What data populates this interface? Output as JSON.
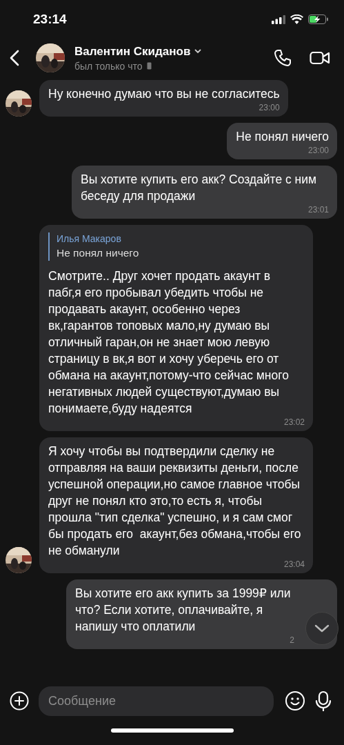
{
  "status_bar": {
    "time": "23:14"
  },
  "header": {
    "name": "Валентин Скиданов",
    "status": "был только что"
  },
  "messages": [
    {
      "kind": "incoming",
      "avatar": true,
      "text": "Ну конечно думаю что вы не согласитесь",
      "time": "23:00"
    },
    {
      "kind": "outgoing",
      "text": "Не понял ничего",
      "time": "23:00"
    },
    {
      "kind": "outgoing",
      "text": "Вы хотите купить его акк? Создайте с ним беседу для продажи",
      "time": "23:01"
    },
    {
      "kind": "incoming",
      "avatar": false,
      "reply": {
        "author": "Илья Макаров",
        "text": "Не понял ничего"
      },
      "text": "Смотрите.. Друг хочет продать акаунт в пабг,я его пробывал убедить чтобы не продавать акаунт, особенно через вк,гарантов топовых мало,ну думаю вы отличный гаран,он не знает мою левую страницу в вк,я вот и хочу уберечь его от обмана на акаунт,потому-что сейчас много негативных людей существуют,думаю вы понимаете,буду надеятся",
      "time": "23:02"
    },
    {
      "kind": "incoming",
      "avatar": true,
      "text": "Я хочу чтобы вы подтвердили сделку не отправляя на ваши реквизиты деньги, после успешной операции,но самое главное чтобы друг не понял кто это,то есть я, чтобы прошла \"тип сделка\" успешно, и я сам смог бы продать его  акаунт,без обмана,чтобы его не обманули",
      "time": "23:04"
    },
    {
      "kind": "outgoing",
      "text": "Вы хотите его акк купить за 1999₽ или что? Если хотите, оплачивайте, я напишу что оплатили",
      "time": "2"
    }
  ],
  "composer": {
    "placeholder": "Сообщение"
  }
}
